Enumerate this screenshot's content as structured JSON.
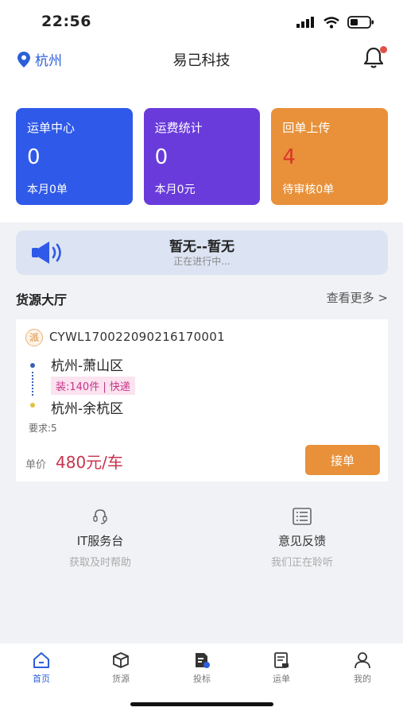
{
  "status_bar": {
    "time": "22:56"
  },
  "header": {
    "location": "杭州",
    "title": "易己科技"
  },
  "stats": [
    {
      "title": "运单中心",
      "value": "0",
      "sub": "本月0单",
      "color": "#2f59e8"
    },
    {
      "title": "运费统计",
      "value": "0",
      "sub": "本月0元",
      "color": "#6a3bdb"
    },
    {
      "title": "回单上传",
      "value": "4",
      "sub": "待审核0单",
      "color": "#e8913a"
    }
  ],
  "notice": {
    "title": "暂无--暂无",
    "subtitle": "正在进行中..."
  },
  "hall": {
    "title": "货源大厅",
    "more": "查看更多 >"
  },
  "goods": {
    "tag": "派",
    "code": "CYWL170022090216170001",
    "from": "杭州-萧山区",
    "cargo": "装:140件 | 快递",
    "to": "杭州-余杭区",
    "requirement": "要求:5",
    "price_label": "单价",
    "price": "480元/车",
    "accept_label": "接单"
  },
  "services": [
    {
      "title": "IT服务台",
      "subtitle": "获取及时帮助",
      "icon": "headset-icon"
    },
    {
      "title": "意见反馈",
      "subtitle": "我们正在聆听",
      "icon": "feedback-icon"
    }
  ],
  "tabs": [
    {
      "label": "首页",
      "icon": "home-icon",
      "active": true
    },
    {
      "label": "货源",
      "icon": "box-icon",
      "active": false
    },
    {
      "label": "投标",
      "icon": "bid-icon",
      "active": false
    },
    {
      "label": "运单",
      "icon": "waybill-icon",
      "active": false
    },
    {
      "label": "我的",
      "icon": "user-icon",
      "active": false
    }
  ],
  "colors": {
    "accent": "#2b5fd9",
    "orange": "#e8913a",
    "price": "#c8334d"
  }
}
